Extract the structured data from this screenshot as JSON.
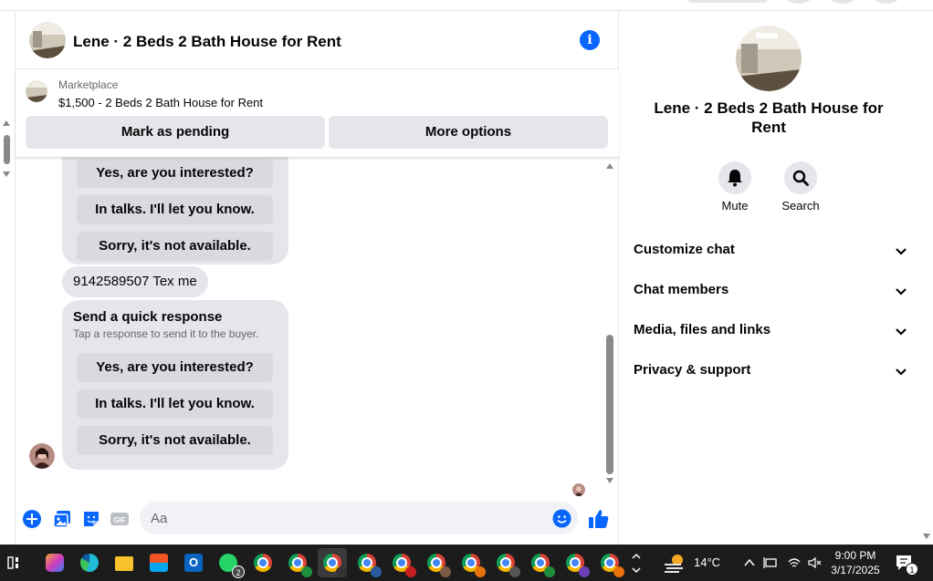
{
  "chat": {
    "title": "Lene · 2 Beds 2 Bath House for Rent",
    "info_icon": "info-icon",
    "listing": {
      "kind": "Marketplace",
      "price_title": "$1,500 - 2 Beds 2 Bath House for Rent",
      "mark_pending": "Mark as pending",
      "more_options": "More options"
    },
    "messages": {
      "group1_replies": [
        "Yes, are you interested?",
        "In talks. I'll let you know.",
        "Sorry, it's not available."
      ],
      "buyer_message": "9142589507 Tex me",
      "quick_title": "Send a quick response",
      "quick_sub": "Tap a response to send it to the buyer.",
      "group2_replies": [
        "Yes, are you interested?",
        "In talks. I'll let you know.",
        "Sorry, it's not available."
      ]
    },
    "composer": {
      "placeholder": "Aa"
    }
  },
  "info_panel": {
    "name": "Lene · 2 Beds 2 Bath House for Rent",
    "actions": [
      {
        "label": "Mute",
        "icon": "bell-icon"
      },
      {
        "label": "Search",
        "icon": "search-icon"
      }
    ],
    "sections": [
      "Customize chat",
      "Chat members",
      "Media, files and links",
      "Privacy & support"
    ]
  },
  "taskbar": {
    "temperature": "14°C",
    "time": "9:00 PM",
    "date": "3/17/2025",
    "whatsapp_badge": "2",
    "notification_badge": "1"
  },
  "colors": {
    "accent": "#0866ff",
    "bubble": "#e4e6eb",
    "quick_reply": "#d8dadf",
    "taskbar": "#1c1c1c"
  }
}
